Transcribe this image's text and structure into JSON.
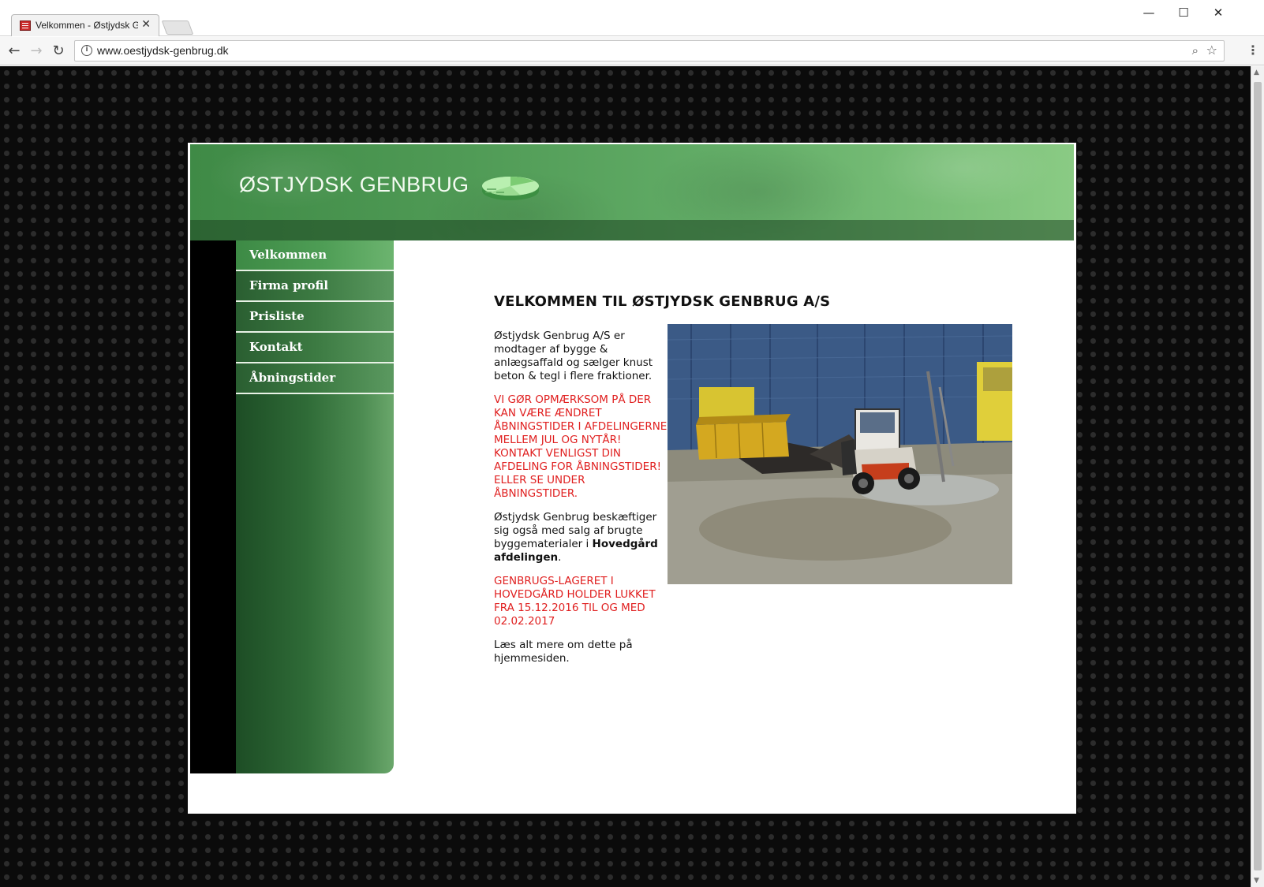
{
  "browser": {
    "tab_title": "Velkommen - Østjydsk Genbrug",
    "tab_close": "✕",
    "url": "www.oestjydsk-genbrug.dk",
    "window_controls": {
      "minimize": "—",
      "maximize": "☐",
      "close": "✕"
    },
    "nav": {
      "back": "←",
      "forward": "→",
      "reload": "↻"
    },
    "icons": {
      "info": "i",
      "zoom": "⌕",
      "star": "☆",
      "menu": "⋮"
    }
  },
  "site": {
    "logo_text": "ØSTJYDSK GENBRUG",
    "nav_items": [
      {
        "label": "Velkommen",
        "active": true
      },
      {
        "label": "Firma profil",
        "active": false
      },
      {
        "label": "Prisliste",
        "active": false
      },
      {
        "label": "Kontakt",
        "active": false
      },
      {
        "label": "Åbningstider",
        "active": false
      }
    ],
    "heading": "VELKOMMEN TIL ØSTJYDSK GENBRUG A/S",
    "intro": "Østjydsk Genbrug A/S er modtager af bygge & anlægsaffald og sælger knust beton & tegl i flere fraktioner.",
    "notice_lines": [
      "VI GØR OPMÆRKSOM PÅ DER KAN VÆRE ÆNDRET ÅBNINGSTIDER I AFDELINGERNE MELLEM JUL OG NYTÅR!",
      "KONTAKT VENLIGST DIN AFDELING FOR ÅBNINGSTIDER!",
      "ELLER SE UNDER ÅBNINGSTIDER."
    ],
    "para2_before": "Østjydsk Genbrug beskæftiger sig også med salg af brugte byggematerialer i ",
    "para2_bold": "Hovedgård afdelingen",
    "para2_after": ".",
    "notice2": "GENBRUGS-LAGERET I HOVEDGÅRD HOLDER LUKKET FRA 15.12.2016 TIL OG MED 02.02.2017",
    "closing": "Læs alt mere om dette på hjemmesiden."
  },
  "colors": {
    "brand_green": "#4f9a55",
    "notice_red": "#e02020"
  }
}
